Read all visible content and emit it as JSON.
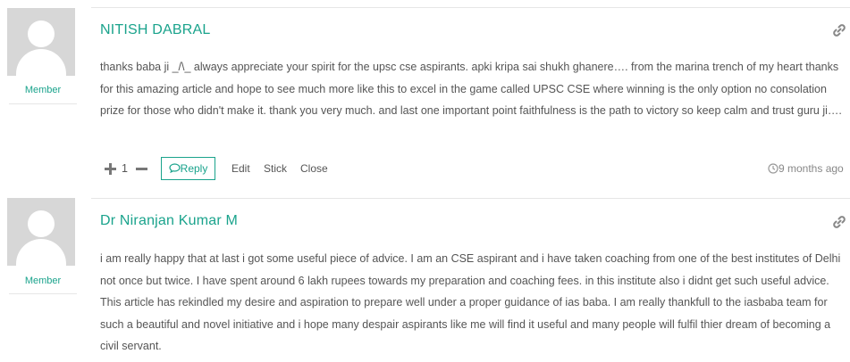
{
  "comments": [
    {
      "author": "NITISH DABRAL",
      "role": "Member",
      "text": "thanks baba ji _/\\_ always appreciate your spirit for the upsc cse aspirants. apki kripa sai shukh ghanere…. from the marina trench of my heart thanks for this amazing article and hope to see much more like this to excel in the game called UPSC CSE where winning is the only option no consolation prize for those who didn't make it. thank you very much. and last one important point faithfulness is the path to victory so keep calm and trust guru ji….",
      "votes": "1",
      "reply_label": "Reply",
      "edit_label": "Edit",
      "stick_label": "Stick",
      "close_label": "Close",
      "time": "9 months ago"
    },
    {
      "author": "Dr Niranjan Kumar M",
      "role": "Member",
      "text": "i am really happy that at last i got some useful piece of advice. I am an CSE aspirant and i have taken coaching from one of the best institutes of Delhi not once but twice. I have spent around 6 lakh rupees towards my preparation and coaching fees. in this institute also i didnt get such useful advice. This article has rekindled my desire and aspiration to prepare well under a proper guidance of ias baba. I am really thankfull to the iasbaba team for such a beautiful and novel initiative and i hope many despair aspirants like me will find it useful and many people will fulfil thier dream of becoming a civil servant."
    }
  ],
  "icons": {
    "permalink": "link-icon",
    "vote_up": "plus-icon",
    "vote_down": "minus-icon",
    "reply": "speech-bubble-icon",
    "time": "clock-icon"
  },
  "colors": {
    "accent": "#1aa38c",
    "divider": "#e6e6e6",
    "avatar_bg": "#d7d7d7"
  }
}
